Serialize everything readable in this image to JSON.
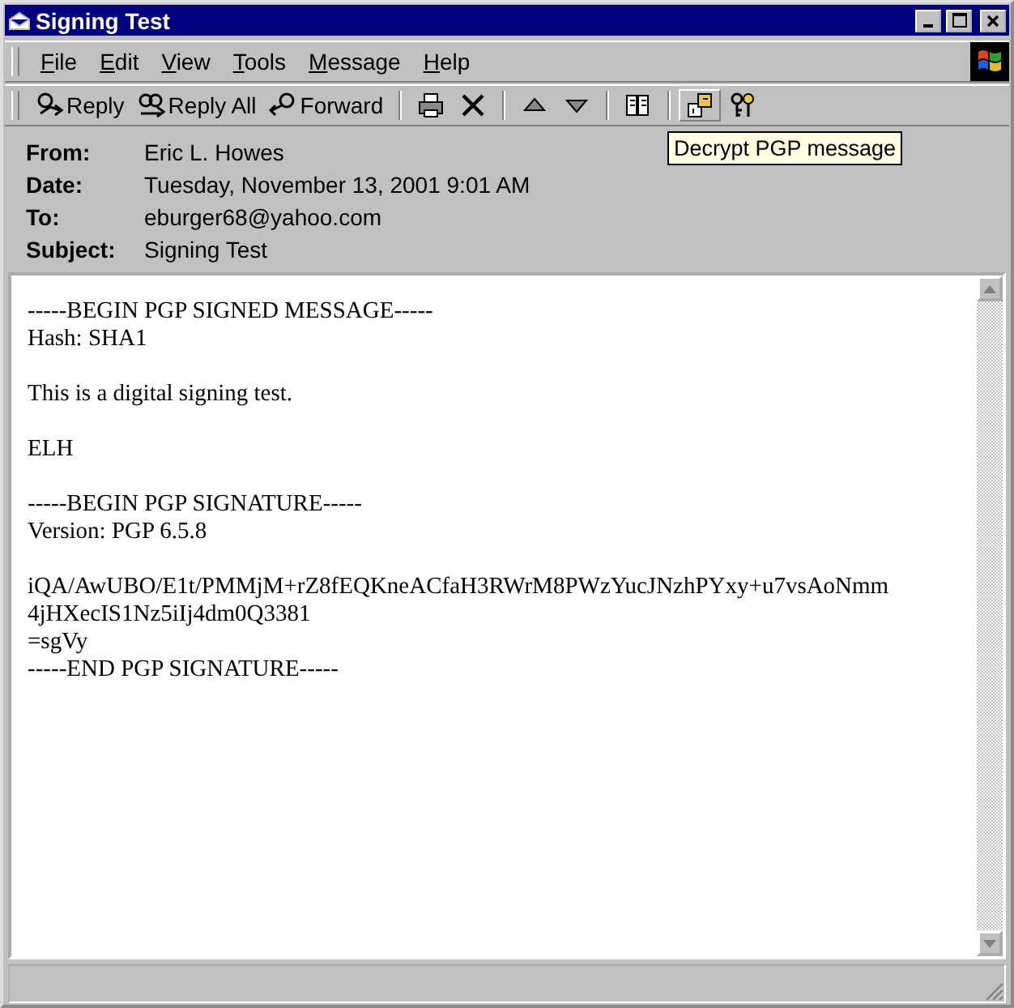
{
  "window": {
    "title": "Signing Test"
  },
  "menu": [
    "File",
    "Edit",
    "View",
    "Tools",
    "Message",
    "Help"
  ],
  "toolbar": [
    {
      "kind": "button",
      "label": "Reply",
      "hovered": false
    },
    {
      "kind": "button",
      "label": "Reply All",
      "hovered": false
    },
    {
      "kind": "button",
      "label": "Forward",
      "hovered": false
    },
    {
      "kind": "separator"
    },
    {
      "kind": "button",
      "hovered": false
    },
    {
      "kind": "button",
      "hovered": false
    },
    {
      "kind": "separator"
    },
    {
      "kind": "button",
      "hovered": false
    },
    {
      "kind": "button",
      "hovered": false
    },
    {
      "kind": "separator"
    },
    {
      "kind": "button",
      "hovered": false
    },
    {
      "kind": "separator"
    },
    {
      "kind": "button",
      "hovered": true
    },
    {
      "kind": "button",
      "hovered": false
    }
  ],
  "tooltip": "Decrypt PGP message",
  "header": [
    {
      "label": "From:",
      "value": "Eric L. Howes"
    },
    {
      "label": "Date:",
      "value": "Tuesday, November 13, 2001 9:01 AM"
    },
    {
      "label": "To:",
      "value": "eburger68@yahoo.com"
    },
    {
      "label": "Subject:",
      "value": "Signing Test"
    }
  ],
  "body": [
    [
      "-----BEGIN PGP SIGNED MESSAGE-----",
      "Hash: SHA1"
    ],
    [
      "This is a digital signing test."
    ],
    [
      "ELH"
    ],
    [
      "-----BEGIN PGP SIGNATURE-----",
      "Version: PGP 6.5.8"
    ],
    [
      "iQA/AwUBO/E1t/PMMjM+rZ8fEQKneACfaH3RWrM8PWzYucJNzhPYxy+u7vsAoNmm",
      "4jHXecIS1Nz5iIj4dm0Q3381",
      "=sgVy",
      "-----END PGP SIGNATURE-----"
    ]
  ]
}
